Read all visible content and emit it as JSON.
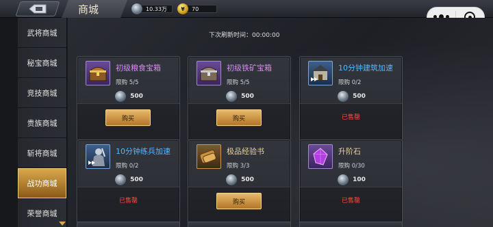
{
  "header": {
    "title": "商城",
    "currency_steel": "10.33万",
    "currency_gold": "70"
  },
  "sidebar": {
    "items": [
      {
        "label": "武将商城"
      },
      {
        "label": "秘宝商城"
      },
      {
        "label": "竞技商城"
      },
      {
        "label": "贵族商城"
      },
      {
        "label": "斩将商城"
      },
      {
        "label": "战功商城"
      },
      {
        "label": "荣誉商城"
      }
    ],
    "active_index": 5
  },
  "main": {
    "refresh_text": "下次刷新时间：00:00:00",
    "cards": [
      {
        "name": "初级粮食宝箱",
        "limit": "限购  5/5",
        "price": "500",
        "action": "购买",
        "sold": false
      },
      {
        "name": "初级铁矿宝箱",
        "limit": "限购  5/5",
        "price": "500",
        "action": "购买",
        "sold": false
      },
      {
        "name": "10分钟建筑加速",
        "limit": "限购  0/2",
        "price": "500",
        "action": "已售罄",
        "sold": true
      },
      {
        "name": "10分钟练兵加速",
        "limit": "限购  0/2",
        "price": "500",
        "action": "已售罄",
        "sold": true
      },
      {
        "name": "极品经验书",
        "limit": "限购  3/3",
        "price": "500",
        "action": "购买",
        "sold": false
      },
      {
        "name": "升阶石",
        "limit": "限购  0/30",
        "price": "100",
        "action": "已售罄",
        "sold": true
      }
    ]
  },
  "colors": {
    "accent_gold": "#d9a84c",
    "sold_red": "#ff4b3e",
    "name_purple": "#d88af2",
    "name_blue": "#52b8ff"
  }
}
